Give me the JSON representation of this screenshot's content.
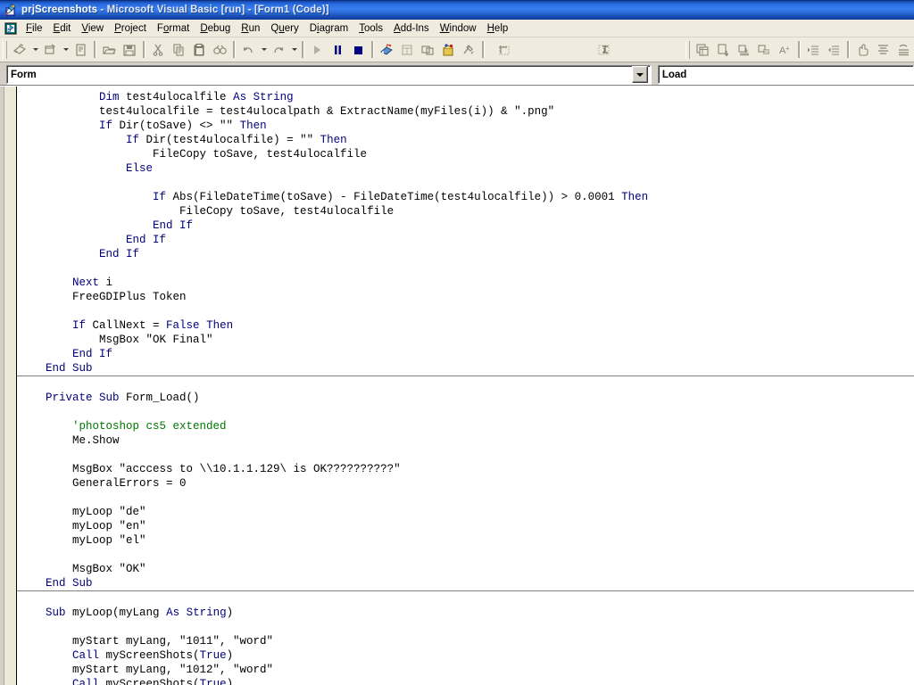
{
  "window": {
    "title_project": "prjScreenshots",
    "title_rest": " - Microsoft Visual Basic [run] - [Form1 (Code)]",
    "icon": "vb-project-icon"
  },
  "menubar": {
    "doc_icon": "mdi-document-icon",
    "items": [
      {
        "label": "File",
        "accel": "F"
      },
      {
        "label": "Edit",
        "accel": "E"
      },
      {
        "label": "View",
        "accel": "V"
      },
      {
        "label": "Project",
        "accel": "P"
      },
      {
        "label": "Format",
        "accel": "o"
      },
      {
        "label": "Debug",
        "accel": "D"
      },
      {
        "label": "Run",
        "accel": "R"
      },
      {
        "label": "Query",
        "accel": "u"
      },
      {
        "label": "Diagram",
        "accel": "i"
      },
      {
        "label": "Tools",
        "accel": "T"
      },
      {
        "label": "Add-Ins",
        "accel": "A"
      },
      {
        "label": "Window",
        "accel": "W"
      },
      {
        "label": "Help",
        "accel": "H"
      }
    ]
  },
  "toolbar": {
    "buttons": [
      "add-project-icon",
      "add-form-icon",
      "menu-editor-icon",
      "open-project-icon",
      "save-project-icon",
      "cut-icon",
      "copy-icon",
      "paste-icon",
      "find-icon",
      "undo-icon",
      "redo-icon",
      "start-icon",
      "break-icon",
      "end-icon",
      "project-explorer-icon",
      "properties-window-icon",
      "form-layout-icon",
      "object-browser-icon",
      "toolbox-icon",
      "data-view-icon",
      "visual-component-manager-icon",
      "new-table-icon",
      "new-view-icon",
      "new-stored-procedure-icon",
      "new-trigger-icon",
      "verify-sql-syntax-icon",
      "indent-icon",
      "outdent-icon",
      "hand-icon",
      "align-icon",
      "position-icon"
    ]
  },
  "code_header": {
    "object_combo_value": "Form",
    "procedure_combo_value": "Load"
  },
  "code": {
    "blocks": [
      {
        "id": "block-myscreenshots-tail",
        "lines": [
          [
            {
              "t": "            ",
              "c": ""
            },
            {
              "t": "Dim",
              "c": "kw"
            },
            {
              "t": " test4ulocalfile ",
              "c": ""
            },
            {
              "t": "As",
              "c": "kw"
            },
            {
              "t": " ",
              "c": ""
            },
            {
              "t": "String",
              "c": "kw"
            }
          ],
          [
            {
              "t": "            test4ulocalfile = test4ulocalpath & ExtractName(myFiles(i)) & \".png\"",
              "c": ""
            }
          ],
          [
            {
              "t": "            ",
              "c": ""
            },
            {
              "t": "If",
              "c": "kw"
            },
            {
              "t": " Dir(toSave) <> \"\" ",
              "c": ""
            },
            {
              "t": "Then",
              "c": "kw"
            }
          ],
          [
            {
              "t": "                ",
              "c": ""
            },
            {
              "t": "If",
              "c": "kw"
            },
            {
              "t": " Dir(test4ulocalfile) = \"\" ",
              "c": ""
            },
            {
              "t": "Then",
              "c": "kw"
            }
          ],
          [
            {
              "t": "                    FileCopy toSave, test4ulocalfile",
              "c": ""
            }
          ],
          [
            {
              "t": "                ",
              "c": ""
            },
            {
              "t": "Else",
              "c": "kw"
            }
          ],
          [
            {
              "t": "",
              "c": ""
            }
          ],
          [
            {
              "t": "                    ",
              "c": ""
            },
            {
              "t": "If",
              "c": "kw"
            },
            {
              "t": " Abs(FileDateTime(toSave) - FileDateTime(test4ulocalfile)) > 0.0001 ",
              "c": ""
            },
            {
              "t": "Then",
              "c": "kw"
            }
          ],
          [
            {
              "t": "                        FileCopy toSave, test4ulocalfile",
              "c": ""
            }
          ],
          [
            {
              "t": "                    ",
              "c": ""
            },
            {
              "t": "End If",
              "c": "kw"
            }
          ],
          [
            {
              "t": "                ",
              "c": ""
            },
            {
              "t": "End If",
              "c": "kw"
            }
          ],
          [
            {
              "t": "            ",
              "c": ""
            },
            {
              "t": "End If",
              "c": "kw"
            }
          ],
          [
            {
              "t": "",
              "c": ""
            }
          ],
          [
            {
              "t": "        ",
              "c": ""
            },
            {
              "t": "Next",
              "c": "kw"
            },
            {
              "t": " i",
              "c": ""
            }
          ],
          [
            {
              "t": "        FreeGDIPlus Token",
              "c": ""
            }
          ],
          [
            {
              "t": "",
              "c": ""
            }
          ],
          [
            {
              "t": "        ",
              "c": ""
            },
            {
              "t": "If",
              "c": "kw"
            },
            {
              "t": " CallNext = ",
              "c": ""
            },
            {
              "t": "False",
              "c": "kw"
            },
            {
              "t": " ",
              "c": ""
            },
            {
              "t": "Then",
              "c": "kw"
            }
          ],
          [
            {
              "t": "            MsgBox \"OK Final\"",
              "c": ""
            }
          ],
          [
            {
              "t": "        ",
              "c": ""
            },
            {
              "t": "End If",
              "c": "kw"
            }
          ],
          [
            {
              "t": "    ",
              "c": ""
            },
            {
              "t": "End Sub",
              "c": "kw"
            }
          ]
        ]
      },
      {
        "id": "block-form-load",
        "lines": [
          [
            {
              "t": "",
              "c": ""
            }
          ],
          [
            {
              "t": "    ",
              "c": ""
            },
            {
              "t": "Private Sub",
              "c": "kw"
            },
            {
              "t": " Form_Load()",
              "c": ""
            }
          ],
          [
            {
              "t": "",
              "c": ""
            }
          ],
          [
            {
              "t": "        ",
              "c": ""
            },
            {
              "t": "'photoshop cs5 extended",
              "c": "cm"
            }
          ],
          [
            {
              "t": "        Me.Show",
              "c": ""
            }
          ],
          [
            {
              "t": "",
              "c": ""
            }
          ],
          [
            {
              "t": "        MsgBox \"acccess to \\\\10.1.1.129\\ is OK??????????\"",
              "c": ""
            }
          ],
          [
            {
              "t": "        GeneralErrors = 0",
              "c": ""
            }
          ],
          [
            {
              "t": "",
              "c": ""
            }
          ],
          [
            {
              "t": "        myLoop \"de\"",
              "c": ""
            }
          ],
          [
            {
              "t": "        myLoop \"en\"",
              "c": ""
            }
          ],
          [
            {
              "t": "        myLoop \"el\"",
              "c": ""
            }
          ],
          [
            {
              "t": "",
              "c": ""
            }
          ],
          [
            {
              "t": "        MsgBox \"OK\"",
              "c": ""
            }
          ],
          [
            {
              "t": "    ",
              "c": ""
            },
            {
              "t": "End Sub",
              "c": "kw"
            }
          ]
        ]
      },
      {
        "id": "block-myloop",
        "lines": [
          [
            {
              "t": "",
              "c": ""
            }
          ],
          [
            {
              "t": "    ",
              "c": ""
            },
            {
              "t": "Sub",
              "c": "kw"
            },
            {
              "t": " myLoop(myLang ",
              "c": ""
            },
            {
              "t": "As",
              "c": "kw"
            },
            {
              "t": " ",
              "c": ""
            },
            {
              "t": "String",
              "c": "kw"
            },
            {
              "t": ")",
              "c": ""
            }
          ],
          [
            {
              "t": "",
              "c": ""
            }
          ],
          [
            {
              "t": "        myStart myLang, \"1011\", \"word\"",
              "c": ""
            }
          ],
          [
            {
              "t": "        ",
              "c": ""
            },
            {
              "t": "Call",
              "c": "kw"
            },
            {
              "t": " myScreenShots(",
              "c": ""
            },
            {
              "t": "True",
              "c": "kw"
            },
            {
              "t": ")",
              "c": ""
            }
          ],
          [
            {
              "t": "        myStart myLang, \"1012\", \"word\"",
              "c": ""
            }
          ],
          [
            {
              "t": "        ",
              "c": ""
            },
            {
              "t": "Call",
              "c": "kw"
            },
            {
              "t": " myScreenShots(",
              "c": ""
            },
            {
              "t": "True",
              "c": "kw"
            },
            {
              "t": ")",
              "c": ""
            }
          ]
        ]
      }
    ]
  },
  "colors": {
    "titlebar_start": "#0a246a",
    "titlebar_mid": "#3a7ef0",
    "chrome": "#d4d0c8",
    "toolbar_bg": "#efebde",
    "code_bg": "#ffffff",
    "keyword": "#00007f",
    "comment": "#007700",
    "margin_indicator": "#ece9d8"
  }
}
